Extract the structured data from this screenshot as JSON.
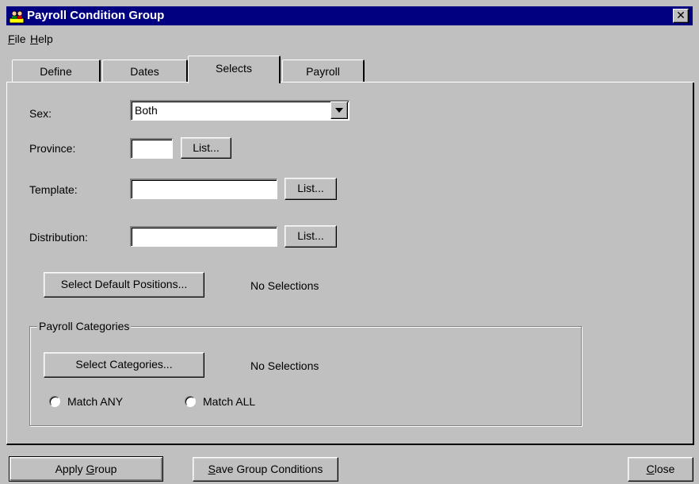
{
  "window": {
    "title": "Payroll Condition Group",
    "close_glyph": "✕",
    "icon": "payroll-app-icon"
  },
  "menu": {
    "file": {
      "label": "File",
      "accel": "F",
      "rest": "ile"
    },
    "help": {
      "label": "Help",
      "accel": "H",
      "rest": "elp"
    }
  },
  "tabs": {
    "define": "Define",
    "dates": "Dates",
    "selects": "Selects",
    "payroll": "Payroll",
    "active": "Selects"
  },
  "form": {
    "sex_label": "Sex:",
    "sex_value": "Both",
    "province_label": "Province:",
    "province_value": "",
    "province_list": "List...",
    "template_label": "Template:",
    "template_value": "",
    "template_list": "List...",
    "distribution_label": "Distribution:",
    "distribution_value": "",
    "distribution_list": "List...",
    "select_positions_button": "Select Default Positions...",
    "positions_status": "No Selections"
  },
  "payroll_categories": {
    "group_title": "Payroll Categories",
    "select_button": "Select Categories...",
    "status": "No Selections",
    "match_any": "Match ANY",
    "match_all": "Match ALL"
  },
  "footer": {
    "apply": {
      "accel_before": "Apply ",
      "accel": "G",
      "after": "roup"
    },
    "save": {
      "accel_before": "",
      "accel": "S",
      "after": "ave Group Conditions"
    },
    "close": {
      "accel_before": "",
      "accel": "C",
      "after": "lose"
    }
  }
}
